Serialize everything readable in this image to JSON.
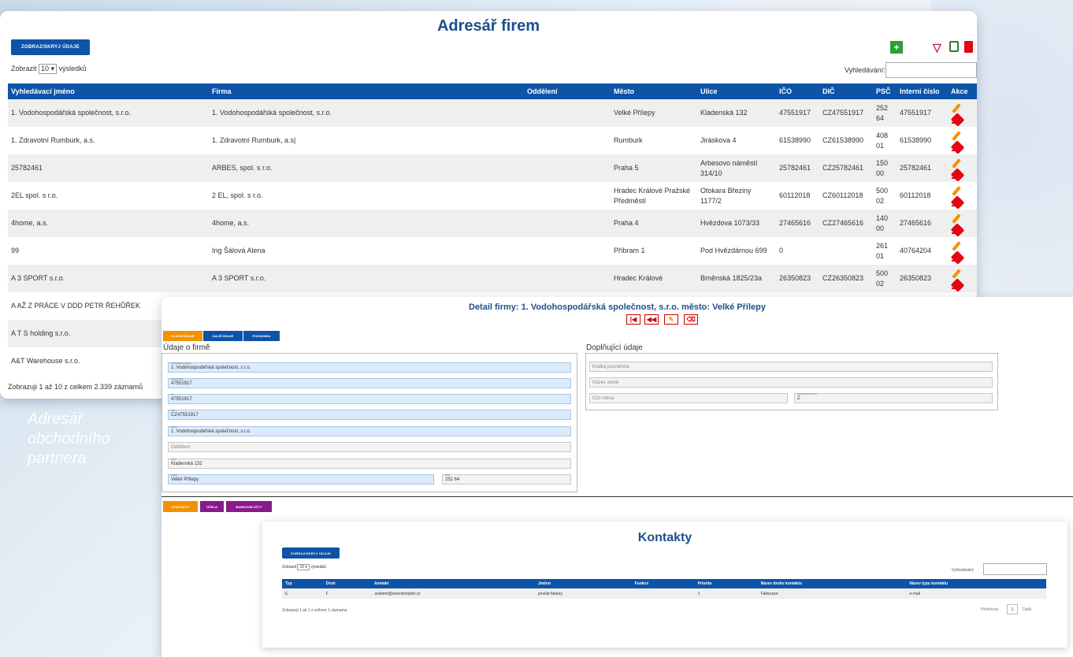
{
  "main": {
    "title": "Adresář firem",
    "toggle_btn": "ZOBRAZ/SKRYJ ÚDAJE",
    "show_prefix": "Zobrazit",
    "page_size": "10",
    "show_suffix": "výsledků",
    "search_label": "Vyhledávání:",
    "columns": [
      "Vyhledávací jméno",
      "Firma",
      "Oddělení",
      "Město",
      "Ulice",
      "IČO",
      "DIČ",
      "PSČ",
      "Interní číslo",
      "Akce"
    ],
    "rows": [
      [
        "1. Vodohospodářská společnost, s.r.o.",
        "1. Vodohospodářská společnost, s.r.o.",
        "",
        "Velké Přílepy",
        "Kladenská 132",
        "47551917",
        "CZ47551917",
        "252 64",
        "47551917"
      ],
      [
        "1. Zdravotní Rumburk, a.s.",
        "1. Zdravotní Rumburk, a.s|",
        "",
        "Rumburk",
        "Jiráskova 4",
        "61538990",
        "CZ61538990",
        "408 01",
        "61538990"
      ],
      [
        "25782461",
        "ARBES, spol. s r.o.",
        "",
        "Praha 5",
        "Arbesovo náměstí 314/10",
        "25782461",
        "CZ25782461",
        "150 00",
        "25782461"
      ],
      [
        "2EL spol. s r.o.",
        "2 EL, spol. s r.o.",
        "",
        "Hradec Králové Pražské Předměstí",
        "Otokara Březiny 1177/2",
        "60112018",
        "CZ60112018",
        "500 02",
        "60112018"
      ],
      [
        "4home, a.s.",
        "4home, a.s.",
        "",
        "Praha 4",
        "Hvězdova 1073/33",
        "27465616",
        "CZ27465616",
        "140 00",
        "27465616"
      ],
      [
        "99",
        "Ing Šálová Alena",
        "",
        "Příbram 1",
        "Pod Hvězdárnou 699",
        "0",
        "",
        "261 01",
        "40764204"
      ],
      [
        "A 3 SPORT s.r.o.",
        "A 3 SPORT s.r.o.",
        "",
        "Hradec Králové",
        "Brněnská 1825/23a",
        "26350823",
        "CZ26350823",
        "500 02",
        "26350823"
      ],
      [
        "A AŽ Z PRÁCE V DDD PETR ŘEHŮŘEK",
        "",
        "",
        "",
        "",
        "",
        "",
        "",
        ""
      ],
      [
        "A T S holding s.r.o.",
        "",
        "",
        "",
        "",
        "",
        "",
        "",
        ""
      ],
      [
        "A&T Warehouse s.r.o.",
        "",
        "",
        "",
        "",
        "",
        "",
        "",
        ""
      ]
    ],
    "info": "Zobrazuji 1 až 10 z celkem 2.339 záznamů",
    "toolbar": {
      "add": "+",
      "filter_color": "#c2185b",
      "save_color": "#2e7d32",
      "delete_color": "#e30613"
    }
  },
  "caption": [
    "Adresář",
    "obchodního",
    "partnera"
  ],
  "detail": {
    "title": "Detail firmy: 1. Vodohospodářská společnost, s.r.o. město: Velké Přílepy",
    "nav": [
      "|◀",
      "◀◀",
      "✎",
      "⌫"
    ],
    "tabs": [
      "HLAVNÍ ÚDAJE",
      "DALŠÍ ÚDAJE",
      "POZNÁMKA"
    ],
    "left_title": "Údaje o firmě",
    "right_title": "Doplňující údaje",
    "fields": [
      {
        "label": "Vyhledávací jméno",
        "value": "1. Vodohospodářská společnost, s.r.o."
      },
      {
        "label": "Interní číslo",
        "value": "47551917"
      },
      {
        "label": "IČ",
        "value": "47551917"
      },
      {
        "label": "DIČ",
        "value": "CZ47551917"
      },
      {
        "label": "Firma",
        "value": "1. Vodohospodářská společnost, s.r.o."
      },
      {
        "label": "",
        "value": "Oddělení"
      },
      {
        "label": "Ulice",
        "value": "Kladenská 132"
      },
      {
        "label": "Město",
        "value": "Velké Přílepy"
      },
      {
        "label": "PSČ",
        "value": "252 64"
      }
    ],
    "right_fields": [
      "Krátká poznámka",
      "Název země",
      "Cizí měna",
      "Z"
    ],
    "right_label": "Druh firmy (Z,D,O)",
    "buttons": [
      "KONTAKTY",
      "ÚČELA",
      "BANKOVNÍ ÚČTY"
    ]
  },
  "contacts": {
    "title": "Kontakty",
    "toggle_btn": "ZOBRAZ/SKRYJ ÚDAJE",
    "show_prefix": "Zobrazit",
    "page_size": "10",
    "show_suffix": "výsledků",
    "search_label": "Vyhledávání:",
    "columns": [
      "Typ",
      "Druh",
      "kontakt",
      "Jméno",
      "Funkce",
      "Priorita",
      "Název druhu kontaktu",
      "Název typu kontaktu"
    ],
    "rows": [
      [
        "E",
        "F",
        "asistent@stavokomplet.cz",
        "posílat faktury",
        "",
        "1",
        "Fakturace",
        "e-mail"
      ]
    ],
    "info": "Zobrazuji 1 až 1 z celkem 1 záznamu",
    "prev": "Předchozí",
    "page": "1",
    "next": "Další"
  }
}
